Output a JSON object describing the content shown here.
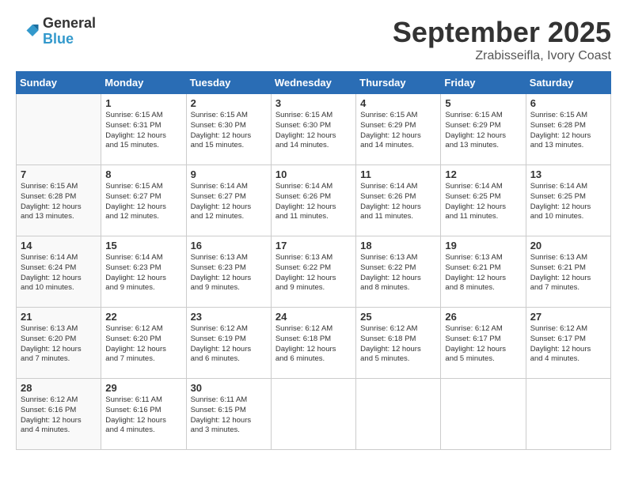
{
  "header": {
    "logo_general": "General",
    "logo_blue": "Blue",
    "month_title": "September 2025",
    "location": "Zrabisseifla, Ivory Coast"
  },
  "days_of_week": [
    "Sunday",
    "Monday",
    "Tuesday",
    "Wednesday",
    "Thursday",
    "Friday",
    "Saturday"
  ],
  "weeks": [
    [
      {
        "day": "",
        "info": ""
      },
      {
        "day": "1",
        "info": "Sunrise: 6:15 AM\nSunset: 6:31 PM\nDaylight: 12 hours\nand 15 minutes."
      },
      {
        "day": "2",
        "info": "Sunrise: 6:15 AM\nSunset: 6:30 PM\nDaylight: 12 hours\nand 15 minutes."
      },
      {
        "day": "3",
        "info": "Sunrise: 6:15 AM\nSunset: 6:30 PM\nDaylight: 12 hours\nand 14 minutes."
      },
      {
        "day": "4",
        "info": "Sunrise: 6:15 AM\nSunset: 6:29 PM\nDaylight: 12 hours\nand 14 minutes."
      },
      {
        "day": "5",
        "info": "Sunrise: 6:15 AM\nSunset: 6:29 PM\nDaylight: 12 hours\nand 13 minutes."
      },
      {
        "day": "6",
        "info": "Sunrise: 6:15 AM\nSunset: 6:28 PM\nDaylight: 12 hours\nand 13 minutes."
      }
    ],
    [
      {
        "day": "7",
        "info": "Sunrise: 6:15 AM\nSunset: 6:28 PM\nDaylight: 12 hours\nand 13 minutes."
      },
      {
        "day": "8",
        "info": "Sunrise: 6:15 AM\nSunset: 6:27 PM\nDaylight: 12 hours\nand 12 minutes."
      },
      {
        "day": "9",
        "info": "Sunrise: 6:14 AM\nSunset: 6:27 PM\nDaylight: 12 hours\nand 12 minutes."
      },
      {
        "day": "10",
        "info": "Sunrise: 6:14 AM\nSunset: 6:26 PM\nDaylight: 12 hours\nand 11 minutes."
      },
      {
        "day": "11",
        "info": "Sunrise: 6:14 AM\nSunset: 6:26 PM\nDaylight: 12 hours\nand 11 minutes."
      },
      {
        "day": "12",
        "info": "Sunrise: 6:14 AM\nSunset: 6:25 PM\nDaylight: 12 hours\nand 11 minutes."
      },
      {
        "day": "13",
        "info": "Sunrise: 6:14 AM\nSunset: 6:25 PM\nDaylight: 12 hours\nand 10 minutes."
      }
    ],
    [
      {
        "day": "14",
        "info": "Sunrise: 6:14 AM\nSunset: 6:24 PM\nDaylight: 12 hours\nand 10 minutes."
      },
      {
        "day": "15",
        "info": "Sunrise: 6:14 AM\nSunset: 6:23 PM\nDaylight: 12 hours\nand 9 minutes."
      },
      {
        "day": "16",
        "info": "Sunrise: 6:13 AM\nSunset: 6:23 PM\nDaylight: 12 hours\nand 9 minutes."
      },
      {
        "day": "17",
        "info": "Sunrise: 6:13 AM\nSunset: 6:22 PM\nDaylight: 12 hours\nand 9 minutes."
      },
      {
        "day": "18",
        "info": "Sunrise: 6:13 AM\nSunset: 6:22 PM\nDaylight: 12 hours\nand 8 minutes."
      },
      {
        "day": "19",
        "info": "Sunrise: 6:13 AM\nSunset: 6:21 PM\nDaylight: 12 hours\nand 8 minutes."
      },
      {
        "day": "20",
        "info": "Sunrise: 6:13 AM\nSunset: 6:21 PM\nDaylight: 12 hours\nand 7 minutes."
      }
    ],
    [
      {
        "day": "21",
        "info": "Sunrise: 6:13 AM\nSunset: 6:20 PM\nDaylight: 12 hours\nand 7 minutes."
      },
      {
        "day": "22",
        "info": "Sunrise: 6:12 AM\nSunset: 6:20 PM\nDaylight: 12 hours\nand 7 minutes."
      },
      {
        "day": "23",
        "info": "Sunrise: 6:12 AM\nSunset: 6:19 PM\nDaylight: 12 hours\nand 6 minutes."
      },
      {
        "day": "24",
        "info": "Sunrise: 6:12 AM\nSunset: 6:18 PM\nDaylight: 12 hours\nand 6 minutes."
      },
      {
        "day": "25",
        "info": "Sunrise: 6:12 AM\nSunset: 6:18 PM\nDaylight: 12 hours\nand 5 minutes."
      },
      {
        "day": "26",
        "info": "Sunrise: 6:12 AM\nSunset: 6:17 PM\nDaylight: 12 hours\nand 5 minutes."
      },
      {
        "day": "27",
        "info": "Sunrise: 6:12 AM\nSunset: 6:17 PM\nDaylight: 12 hours\nand 4 minutes."
      }
    ],
    [
      {
        "day": "28",
        "info": "Sunrise: 6:12 AM\nSunset: 6:16 PM\nDaylight: 12 hours\nand 4 minutes."
      },
      {
        "day": "29",
        "info": "Sunrise: 6:11 AM\nSunset: 6:16 PM\nDaylight: 12 hours\nand 4 minutes."
      },
      {
        "day": "30",
        "info": "Sunrise: 6:11 AM\nSunset: 6:15 PM\nDaylight: 12 hours\nand 3 minutes."
      },
      {
        "day": "",
        "info": ""
      },
      {
        "day": "",
        "info": ""
      },
      {
        "day": "",
        "info": ""
      },
      {
        "day": "",
        "info": ""
      }
    ]
  ]
}
